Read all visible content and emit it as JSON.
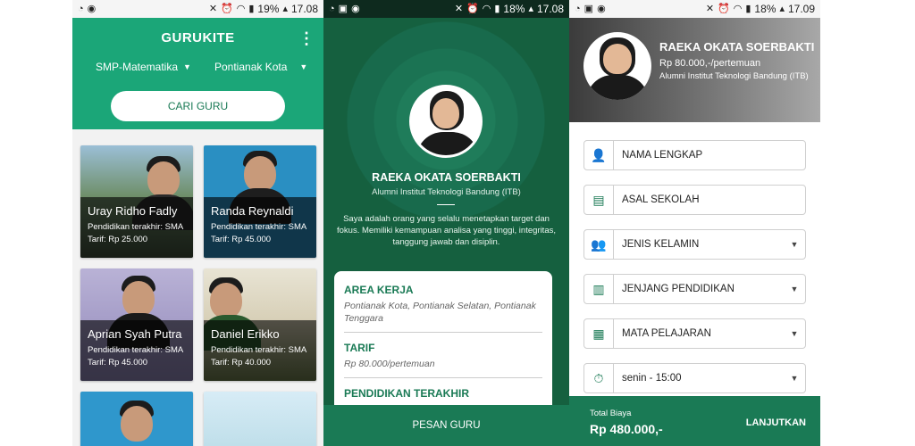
{
  "phone1": {
    "status": {
      "battery": "19%",
      "time": "17.08"
    },
    "title": "GURUKITE",
    "subject_select": "SMP-Matematika",
    "city_select": "Pontianak Kota",
    "search_button": "CARI GURU",
    "teachers": [
      {
        "name": "Uray Ridho Fadly",
        "edu": "Pendidikan terakhir: SMA",
        "rate": "Tarif: Rp 25.000"
      },
      {
        "name": "Randa Reynaldi",
        "edu": "Pendidikan terakhir: SMA",
        "rate": "Tarif: Rp 45.000"
      },
      {
        "name": "Aprian Syah Putra",
        "edu": "Pendidikan terakhir: SMA",
        "rate": "Tarif: Rp 45.000"
      },
      {
        "name": "Daniel Erikko",
        "edu": "Pendidikan terakhir: SMA",
        "rate": "Tarif: Rp 40.000"
      }
    ]
  },
  "phone2": {
    "status": {
      "battery": "18%",
      "time": "17.08"
    },
    "name": "RAEKA OKATA SOERBAKTI",
    "alumni": "Alumni Institut Teknologi Bandung (ITB)",
    "bio": "Saya adalah orang yang selalu menetapkan target dan fokus. Memiliki kemampuan analisa yang tinggi, integritas, tanggung jawab dan disiplin.",
    "area_label": "AREA KERJA",
    "area_value": "Pontianak Kota, Pontianak Selatan, Pontianak Tenggara",
    "tarif_label": "TARIF",
    "tarif_value": "Rp 80.000/pertemuan",
    "edu_label": "PENDIDIKAN TERAKHIR",
    "order_button": "PESAN GURU"
  },
  "phone3": {
    "status": {
      "battery": "18%",
      "time": "17.09"
    },
    "name": "RAEKA OKATA SOERBAKTI",
    "rate": "Rp 80.000,-/pertemuan",
    "alumni": "Alumni Institut Teknologi Bandung (ITB)",
    "fields": {
      "full_name": "NAMA LENGKAP",
      "school": "ASAL SEKOLAH",
      "gender": "JENIS KELAMIN",
      "level": "JENJANG PENDIDIKAN",
      "subject": "MATA PELAJARAN",
      "schedule": "senin - 15:00"
    },
    "total_label": "Total Biaya",
    "total_value": "Rp 480.000,-",
    "next_button": "LANJUTKAN"
  },
  "colors": {
    "primary": "#1a7a55",
    "accent": "#1ba678"
  }
}
